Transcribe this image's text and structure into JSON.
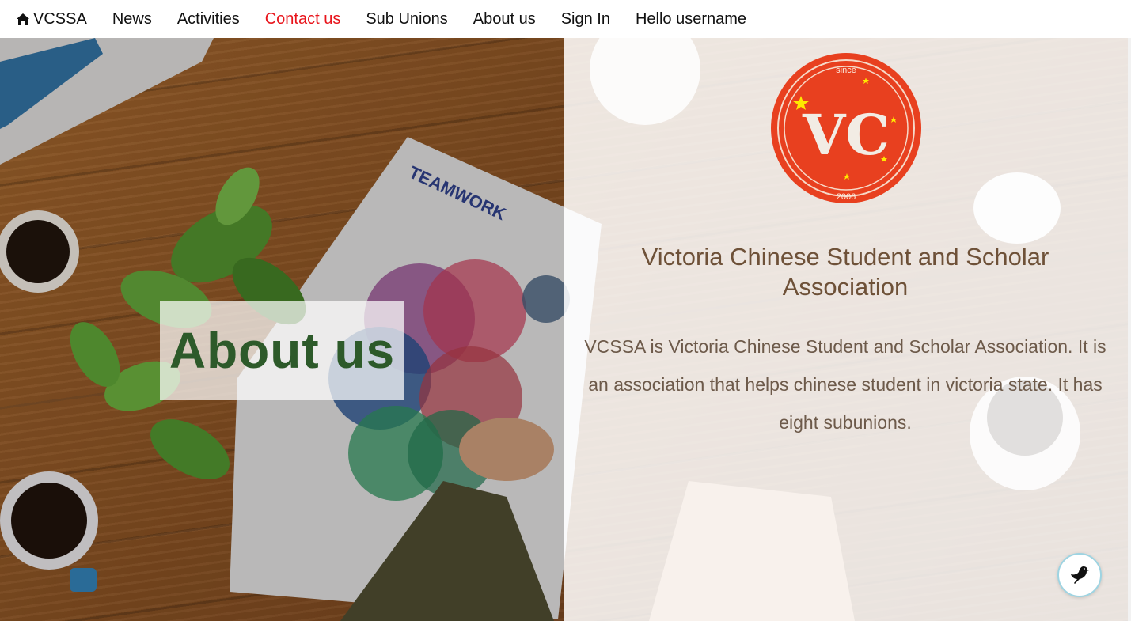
{
  "nav": {
    "brand": "VCSSA",
    "links": [
      "News",
      "Activities",
      "Contact us",
      "Sub Unions",
      "About us",
      "Sign In",
      "Hello username"
    ],
    "active_link": "Contact us",
    "active_color": "#e8141b"
  },
  "hero": {
    "heading": "About us"
  },
  "org": {
    "logo": {
      "top_text": "since",
      "initials": "VC",
      "year": "2006",
      "color": "#e8401f"
    },
    "title": "Victoria Chinese Student and Scholar Association",
    "description": "VCSSA is Victoria Chinese Student and Scholar Association. It is an association that helps chinese student in victoria state. It has eight subunions."
  },
  "chat": {
    "icon": "bird-icon"
  }
}
